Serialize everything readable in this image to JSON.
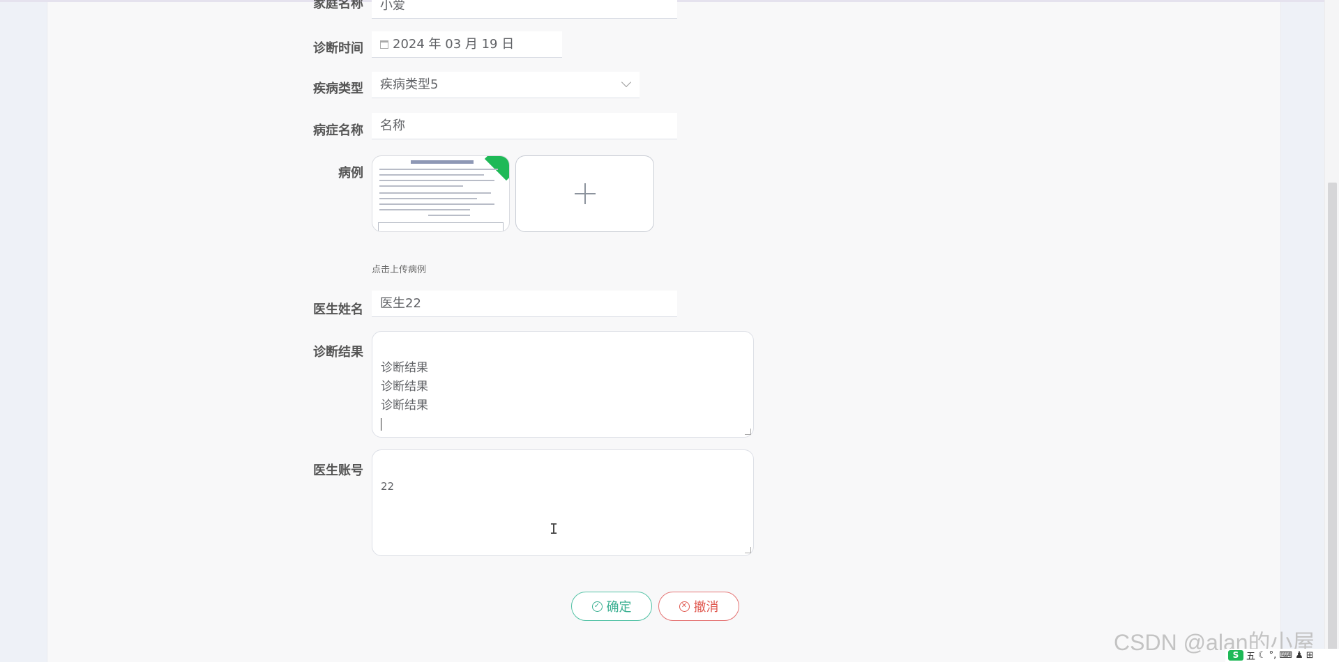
{
  "form": {
    "family_name": {
      "label": "家庭名称",
      "value": "小爱"
    },
    "diagnosis_time": {
      "label": "诊断时间",
      "value": "2024 年 03 月 19 日"
    },
    "disease_type": {
      "label": "疾病类型",
      "value": "疾病类型5"
    },
    "symptom_name": {
      "label": "病症名称",
      "value": "名称"
    },
    "case": {
      "label": "病例",
      "upload_tip": "点击上传病例"
    },
    "doctor_name": {
      "label": "医生姓名",
      "value": "医生22"
    },
    "diagnosis_result": {
      "label": "诊断结果",
      "value": "诊断结果\n诊断结果\n诊断结果\n"
    },
    "doctor_account": {
      "label": "医生账号",
      "value": "22"
    }
  },
  "buttons": {
    "confirm": "确定",
    "cancel": "撤消"
  },
  "watermark": "CSDN @alan的小屋",
  "tray": {
    "ime": "五",
    "icons": [
      "sogou-icon",
      "moon-icon",
      "punct-icon",
      "keyboard-icon",
      "user-icon",
      "grid-icon"
    ]
  },
  "colors": {
    "confirm": "#3aaf91",
    "cancel": "#e0584f",
    "case_badge": "#1fb957"
  }
}
